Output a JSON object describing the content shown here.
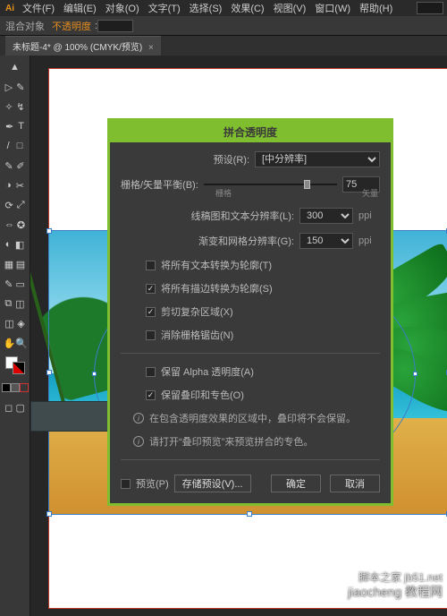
{
  "menu": [
    "文件(F)",
    "编辑(E)",
    "对象(O)",
    "文字(T)",
    "选择(S)",
    "效果(C)",
    "视图(V)",
    "窗口(W)",
    "帮助(H)"
  ],
  "optbar": {
    "label": "混合对象",
    "warn": "不透明度",
    "colon": ":"
  },
  "tab": {
    "title": "未标题-4* @ 100% (CMYK/预览)"
  },
  "dialog": {
    "title": "拼合透明度",
    "preset_label": "预设(R):",
    "preset_value": "[中分辨率]",
    "balance_label": "栅格/矢量平衡(B):",
    "balance_value": "75",
    "balance_left": "栅格",
    "balance_right": "矢量",
    "lineart_label": "线稿图和文本分辨率(L):",
    "lineart_value": "300",
    "gradient_label": "渐变和网格分辨率(G):",
    "gradient_value": "150",
    "ppi": "ppi",
    "check_text": "将所有文本转换为轮廓(T)",
    "check_stroke": "将所有描边转换为轮廓(S)",
    "check_clip": "剪切复杂区域(X)",
    "check_antialias": "消除栅格锯齿(N)",
    "check_alpha": "保留 Alpha 透明度(A)",
    "check_overprint": "保留叠印和专色(O)",
    "info1": "在包含透明度效果的区域中，叠印将不会保留。",
    "info2": "请打开“叠印预览”来预览拼合的专色。",
    "preview_check": "预览(P)",
    "btn_save": "存储预设(V)...",
    "btn_ok": "确定",
    "btn_cancel": "取消"
  },
  "watermark": {
    "line1": "脚本之家 jb51.net",
    "line2": "jiaocheng 教程网"
  }
}
